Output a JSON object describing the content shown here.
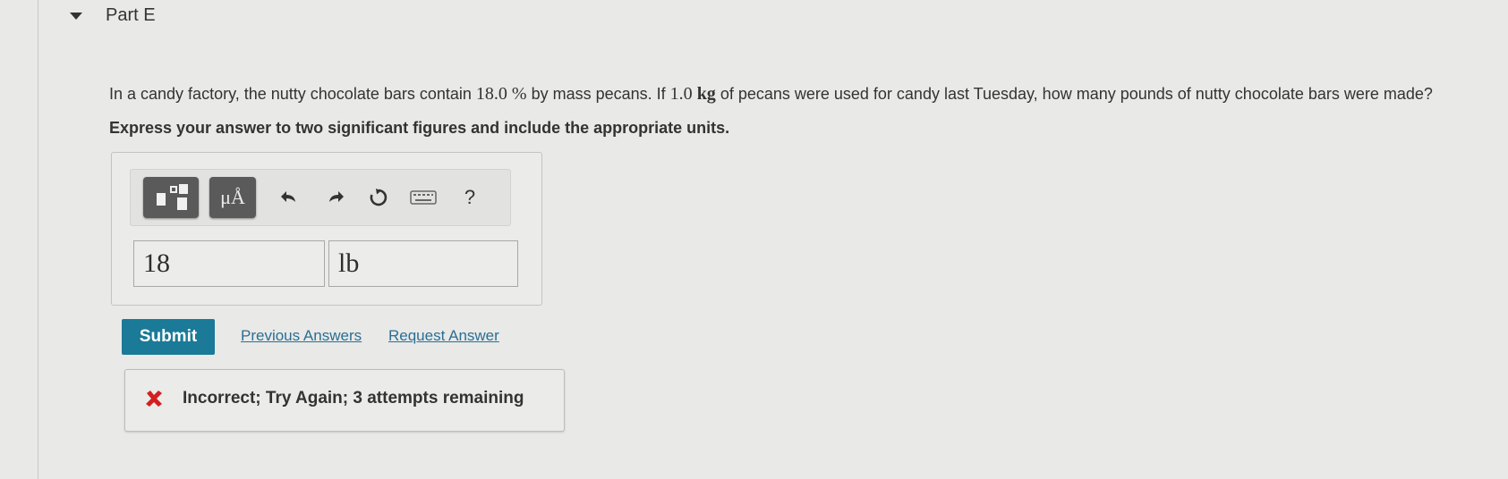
{
  "part": {
    "title": "Part E"
  },
  "question": {
    "text_1": "In a candy factory, the nutty chocolate bars contain ",
    "percent_value": "18.0",
    "percent_unit": "%",
    "text_2": " by mass pecans. If ",
    "mass_value": "1.0",
    "mass_unit": "kg",
    "text_3": " of pecans were used for candy last Tuesday, how many pounds of nutty chocolate bars were made?",
    "instruction": "Express your answer to two significant figures and include the appropriate units."
  },
  "toolbar": {
    "units_label": "μÅ",
    "help_label": "?",
    "icons": [
      "templates-icon",
      "units-icon",
      "undo-icon",
      "redo-icon",
      "reset-icon",
      "keyboard-icon",
      "help-icon"
    ]
  },
  "answer": {
    "value": "18",
    "unit": "lb"
  },
  "actions": {
    "submit_label": "Submit",
    "previous_answers_label": "Previous Answers",
    "request_answer_label": "Request Answer"
  },
  "feedback": {
    "message": "Incorrect; Try Again; 3 attempts remaining",
    "status_color": "#d22020"
  },
  "colors": {
    "accent": "#1a7a98",
    "link": "#2a6f95",
    "background": "#e9e9e7"
  }
}
